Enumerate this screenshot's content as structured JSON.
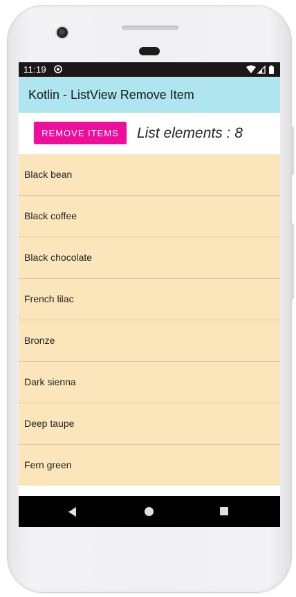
{
  "status_bar": {
    "time": "11:19",
    "icons": [
      "sync-icon",
      "wifi-icon",
      "cellular-signal-icon",
      "battery-icon"
    ]
  },
  "app_bar": {
    "title": "Kotlin - ListView Remove Item",
    "background_color": "#aee5ee"
  },
  "toolbar": {
    "remove_button_label": "REMOVE ITEMS",
    "remove_button_color": "#ef0e9b",
    "count_text": "List elements : 8"
  },
  "list": {
    "item_background": "#fbe6bb",
    "items": [
      {
        "label": "Black bean"
      },
      {
        "label": "Black coffee"
      },
      {
        "label": "Black chocolate"
      },
      {
        "label": "French lilac"
      },
      {
        "label": "Bronze"
      },
      {
        "label": "Dark sienna"
      },
      {
        "label": "Deep taupe"
      },
      {
        "label": "Fern green"
      }
    ]
  },
  "nav_bar": {
    "icons": [
      "back-icon",
      "home-icon",
      "recents-icon"
    ]
  }
}
